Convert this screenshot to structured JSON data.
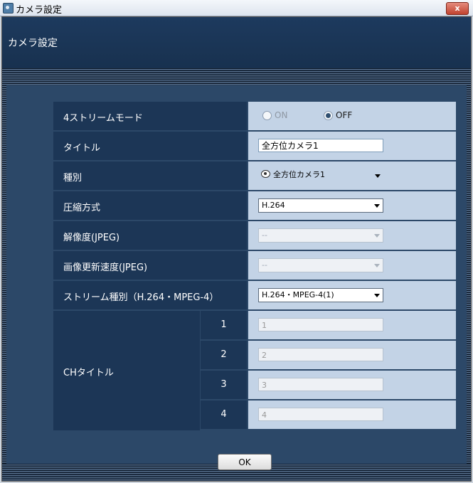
{
  "window": {
    "title": "カメラ設定",
    "close_label": "x"
  },
  "header": {
    "title": "カメラ設定"
  },
  "form": {
    "stream_mode": {
      "label": "4ストリームモード",
      "on_label": "ON",
      "off_label": "OFF",
      "selected": "OFF"
    },
    "title": {
      "label": "タイトル",
      "value": "全方位カメラ1"
    },
    "type": {
      "label": "種別",
      "value": "全方位カメラ1"
    },
    "compression": {
      "label": "圧縮方式",
      "value": "H.264"
    },
    "resolution_jpeg": {
      "label": "解像度(JPEG)",
      "value": "--"
    },
    "refresh_rate_jpeg": {
      "label": "画像更新速度(JPEG)",
      "value": "--"
    },
    "stream_type": {
      "label": "ストリーム種別（H.264・MPEG-4）",
      "value": "H.264・MPEG-4(1)"
    },
    "ch_title": {
      "label": "CHタイトル",
      "channels": [
        {
          "number": "1",
          "value": "1"
        },
        {
          "number": "2",
          "value": "2"
        },
        {
          "number": "3",
          "value": "3"
        },
        {
          "number": "4",
          "value": "4"
        }
      ]
    }
  },
  "ok_label": "OK"
}
